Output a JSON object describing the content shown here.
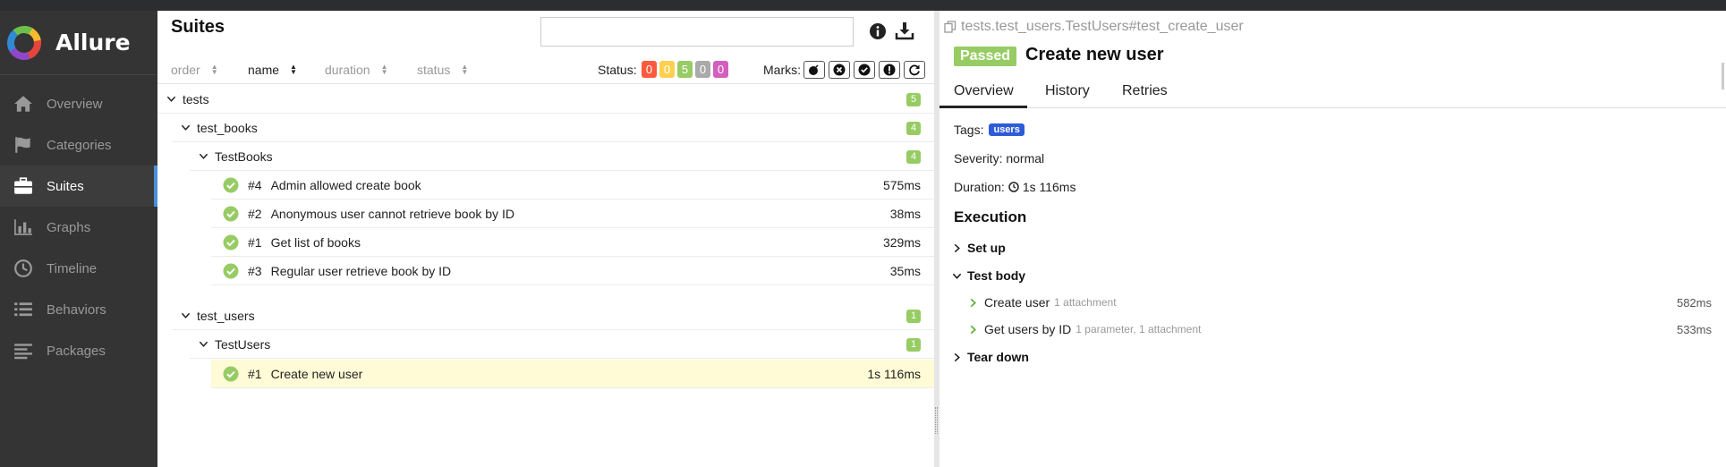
{
  "app": {
    "name": "Allure"
  },
  "sidebar": {
    "items": [
      {
        "label": "Overview",
        "icon": "home-icon"
      },
      {
        "label": "Categories",
        "icon": "flag-icon"
      },
      {
        "label": "Suites",
        "icon": "briefcase-icon",
        "active": true
      },
      {
        "label": "Graphs",
        "icon": "bar-chart-icon"
      },
      {
        "label": "Timeline",
        "icon": "clock-icon"
      },
      {
        "label": "Behaviors",
        "icon": "list-icon"
      },
      {
        "label": "Packages",
        "icon": "align-left-icon"
      }
    ]
  },
  "suites": {
    "title": "Suites",
    "search_value": "",
    "sort": {
      "order": "order",
      "name": "name",
      "duration": "duration",
      "status": "status"
    },
    "status_label": "Status:",
    "status_counts": [
      {
        "value": "0",
        "color": "#fd5a3e"
      },
      {
        "value": "0",
        "color": "#ffd050"
      },
      {
        "value": "5",
        "color": "#97cc64"
      },
      {
        "value": "0",
        "color": "#aaaaaa"
      },
      {
        "value": "0",
        "color": "#d35ebe"
      }
    ],
    "marks_label": "Marks:",
    "tree": {
      "root": {
        "name": "tests",
        "count": "5"
      },
      "test_books": {
        "name": "test_books",
        "count": "4"
      },
      "TestBooks": {
        "name": "TestBooks",
        "count": "4"
      },
      "books_tests": [
        {
          "order": "#4",
          "name": "Admin allowed create book",
          "duration": "575ms"
        },
        {
          "order": "#2",
          "name": "Anonymous user cannot retrieve book by ID",
          "duration": "38ms"
        },
        {
          "order": "#1",
          "name": "Get list of books",
          "duration": "329ms"
        },
        {
          "order": "#3",
          "name": "Regular user retrieve book by ID",
          "duration": "35ms"
        }
      ],
      "test_users": {
        "name": "test_users",
        "count": "1"
      },
      "TestUsers": {
        "name": "TestUsers",
        "count": "1"
      },
      "users_tests": [
        {
          "order": "#1",
          "name": "Create new user",
          "duration": "1s 116ms"
        }
      ]
    }
  },
  "detail": {
    "path": "tests.test_users.TestUsers#test_create_user",
    "status": "Passed",
    "title": "Create new user",
    "tabs": [
      "Overview",
      "History",
      "Retries"
    ],
    "tags_label": "Tags:",
    "tag": "users",
    "severity": "Severity: normal",
    "duration_label": "Duration:",
    "duration": "1s 116ms",
    "execution_title": "Execution",
    "setup": "Set up",
    "test_body": "Test body",
    "steps": [
      {
        "name": "Create user",
        "meta": "1 attachment",
        "duration": "582ms"
      },
      {
        "name": "Get users by ID",
        "meta": "1 parameter, 1 attachment",
        "duration": "533ms"
      }
    ],
    "teardown": "Tear down"
  }
}
